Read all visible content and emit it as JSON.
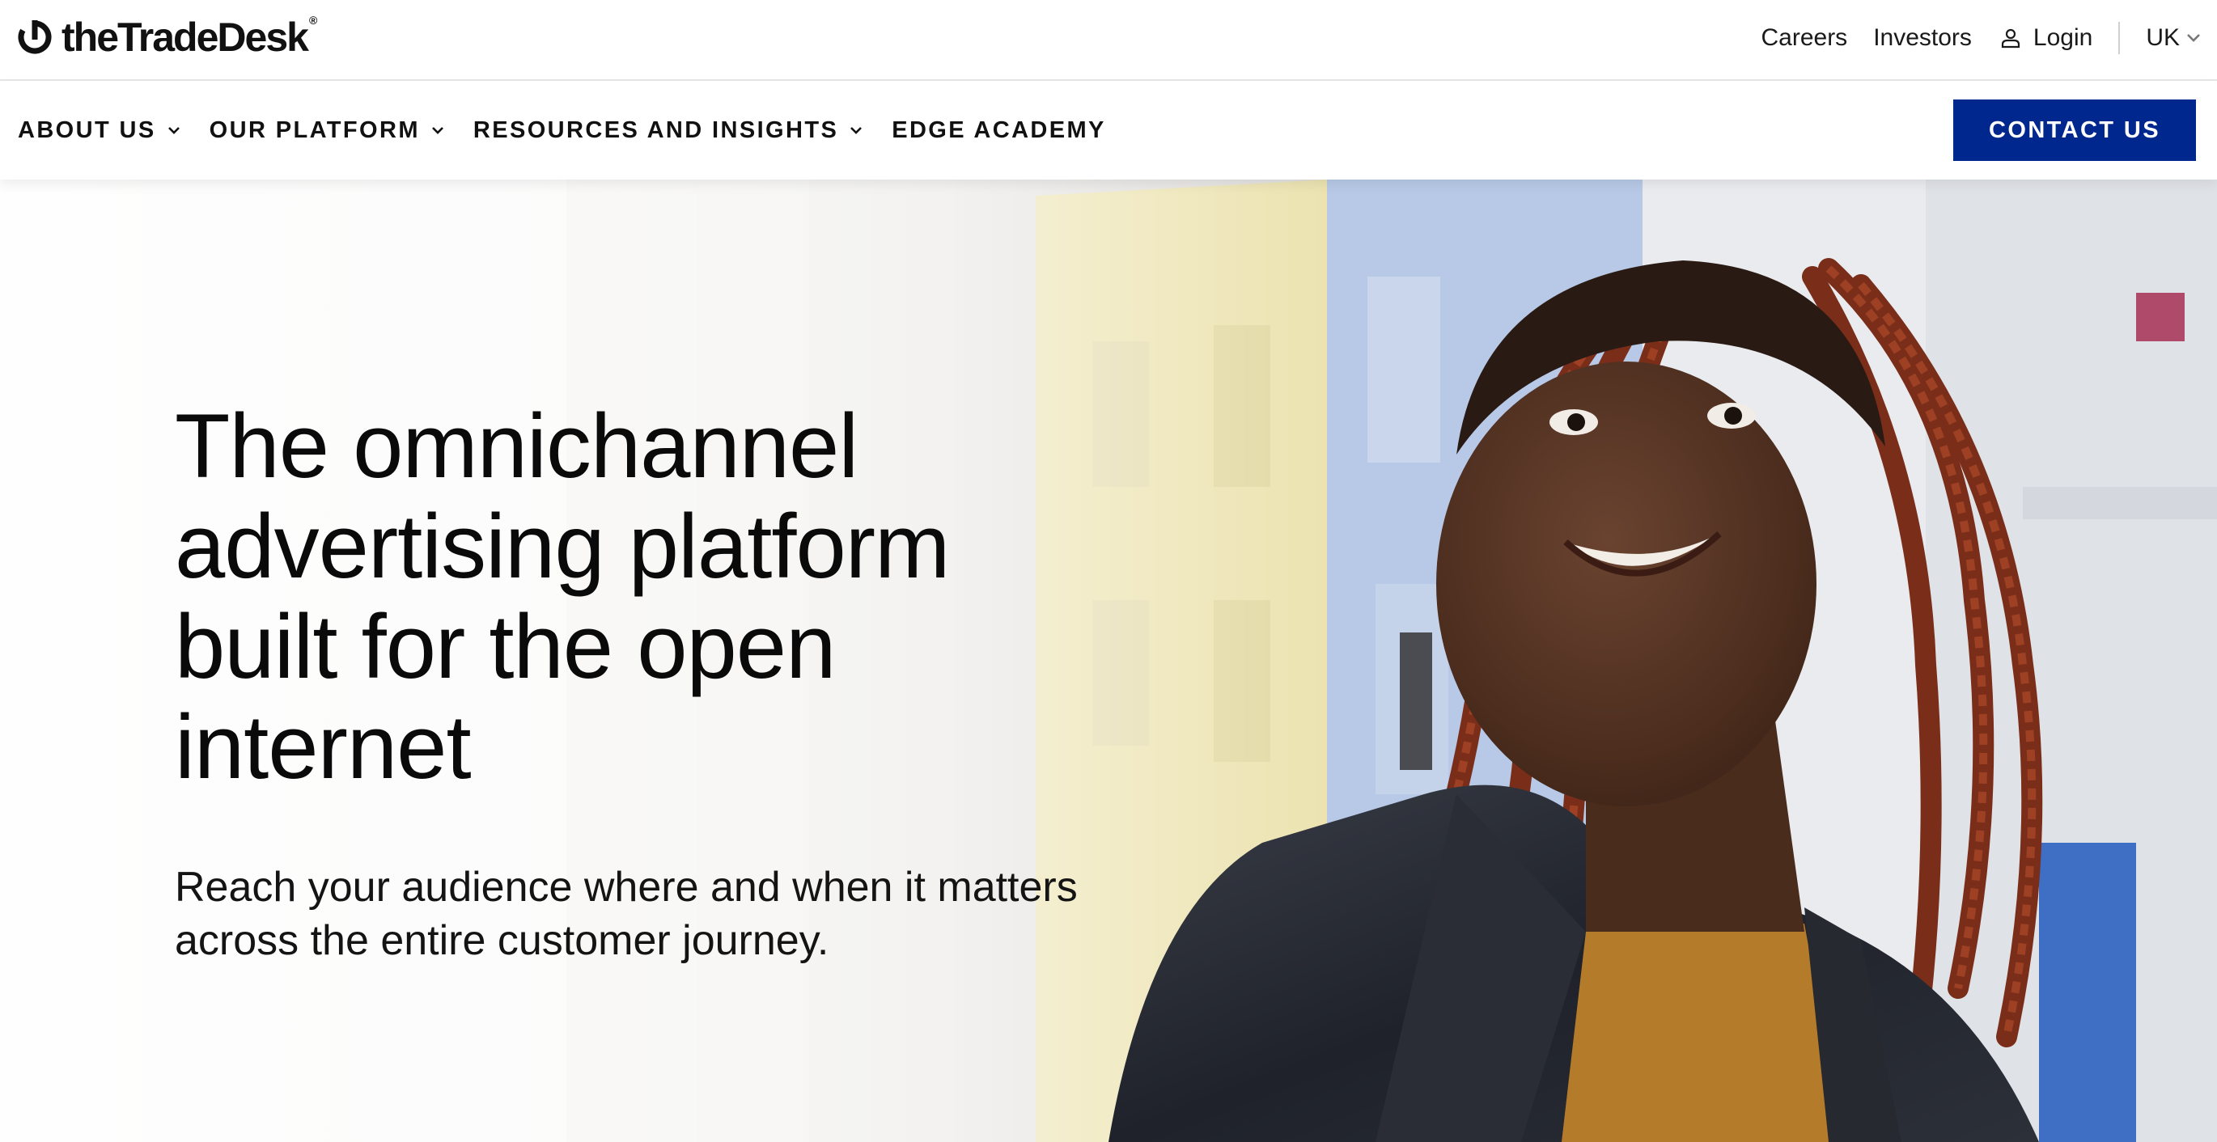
{
  "brand": {
    "logo_text": "theTradeDesk",
    "logo_mark": "ttd-logo-mark",
    "registered": "®"
  },
  "utility_nav": {
    "careers": "Careers",
    "investors": "Investors",
    "login": "Login",
    "login_icon": "user-icon",
    "region": "UK",
    "region_icon": "chevron-down-icon"
  },
  "main_nav": {
    "items": [
      {
        "label": "ABOUT US",
        "has_dropdown": true
      },
      {
        "label": "OUR PLATFORM",
        "has_dropdown": true
      },
      {
        "label": "RESOURCES AND INSIGHTS",
        "has_dropdown": true
      },
      {
        "label": "EDGE ACADEMY",
        "has_dropdown": false
      }
    ],
    "cta": "CONTACT US"
  },
  "hero": {
    "title": "The omnichannel advertising platform built for the open internet",
    "subtitle": "Reach your audience where and when it matters across the entire customer journey."
  },
  "colors": {
    "cta_background": "#00278e",
    "text_primary": "#111111",
    "nav_border": "#e6e6e6"
  }
}
